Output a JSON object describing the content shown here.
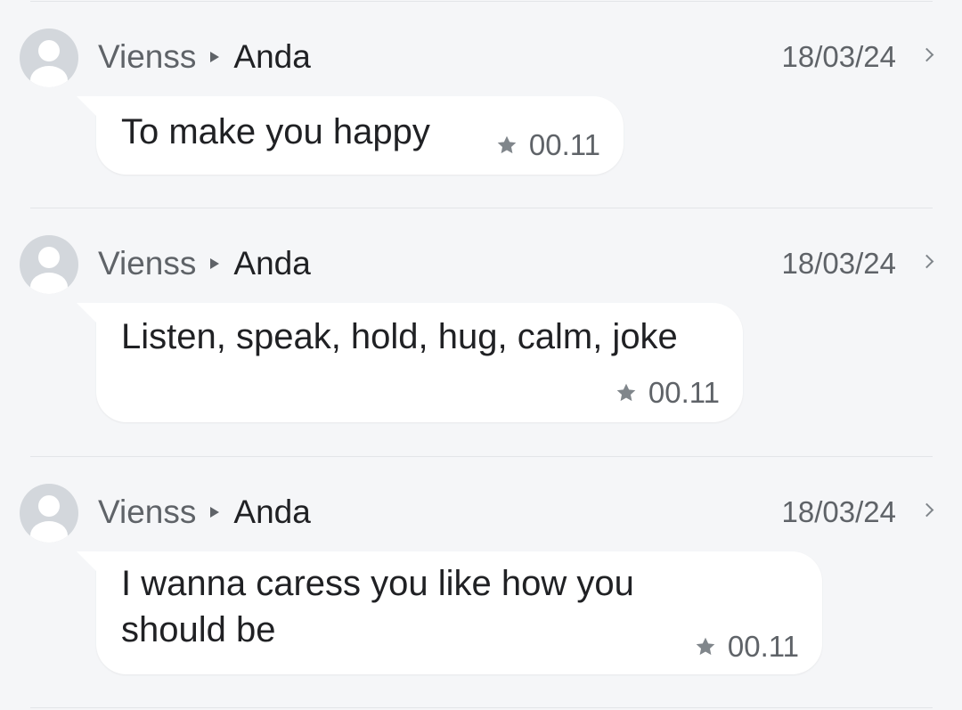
{
  "messages": [
    {
      "sender": "Vienss",
      "recipient": "Anda",
      "date": "18/03/24",
      "text": "To make you happy",
      "time": "00.11"
    },
    {
      "sender": "Vienss",
      "recipient": "Anda",
      "date": "18/03/24",
      "text": "Listen, speak, hold, hug, calm, joke",
      "time": "00.11"
    },
    {
      "sender": "Vienss",
      "recipient": "Anda",
      "date": "18/03/24",
      "text_lines": [
        "I wanna caress you like how you",
        "should be"
      ],
      "time": "00.11"
    }
  ],
  "icons": {
    "avatar": "person-avatar-icon",
    "recipient_arrow": "play-arrow-icon",
    "open": "chevron-right-icon",
    "starred": "star-icon"
  },
  "colors": {
    "background": "#f5f6f8",
    "bubble": "#ffffff",
    "text": "#202124",
    "secondary": "#5f6368"
  }
}
